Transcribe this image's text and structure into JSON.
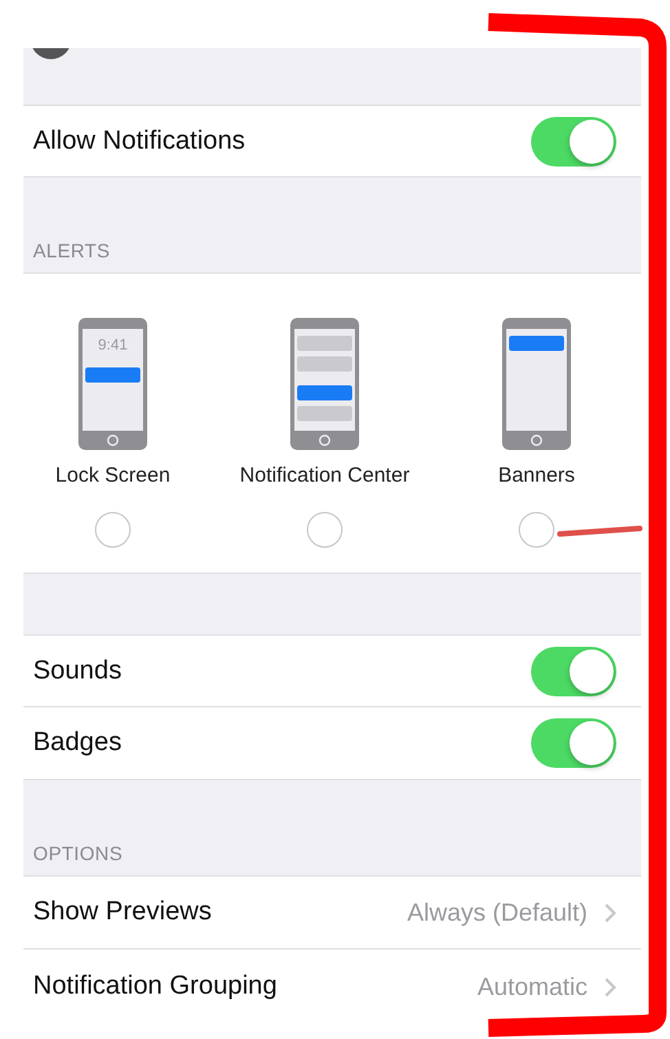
{
  "allow_notifications": {
    "label": "Allow Notifications",
    "on": true
  },
  "alerts": {
    "header": "ALERTS",
    "styles": [
      {
        "kind": "lock-screen",
        "label": "Lock Screen",
        "time": "9:41",
        "selected": false
      },
      {
        "kind": "notification-center",
        "label": "Notification Center",
        "selected": false
      },
      {
        "kind": "banners",
        "label": "Banners",
        "selected": false
      }
    ]
  },
  "toggles": [
    {
      "label": "Sounds",
      "on": true
    },
    {
      "label": "Badges",
      "on": true
    }
  ],
  "options": {
    "header": "OPTIONS",
    "rows": [
      {
        "label": "Show Previews",
        "value": "Always (Default)"
      },
      {
        "label": "Notification Grouping",
        "value": "Automatic"
      }
    ]
  }
}
